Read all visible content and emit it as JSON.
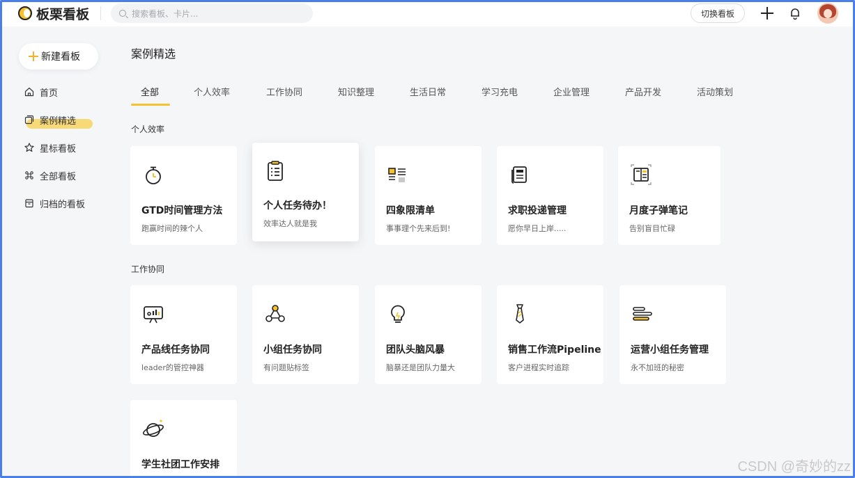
{
  "app": {
    "name": "板栗看板"
  },
  "search": {
    "placeholder": "搜索看板、卡片..."
  },
  "header": {
    "switch_label": "切换看板"
  },
  "sidebar": {
    "new_label": "新建看板",
    "items": [
      {
        "label": "首页",
        "icon": "home-icon"
      },
      {
        "label": "案例精选",
        "icon": "cases-icon",
        "active": true
      },
      {
        "label": "星标看板",
        "icon": "star-icon"
      },
      {
        "label": "全部看板",
        "icon": "command-icon"
      },
      {
        "label": "归档的看板",
        "icon": "archive-icon"
      }
    ]
  },
  "main": {
    "title": "案例精选",
    "tabs": [
      "全部",
      "个人效率",
      "工作协同",
      "知识整理",
      "生活日常",
      "学习充电",
      "企业管理",
      "产品开发",
      "活动策划"
    ],
    "active_tab": 0,
    "sections": [
      {
        "title": "个人效率",
        "cards": [
          {
            "title": "GTD时间管理方法",
            "subtitle": "跑赢时间的辣个人",
            "icon": "stopwatch-icon"
          },
          {
            "title": "个人任务待办！",
            "subtitle": "效率达人就是我",
            "icon": "checklist-icon"
          },
          {
            "title": "四象限清单",
            "subtitle": "事事理个先来后到!",
            "icon": "quadrant-icon"
          },
          {
            "title": "求职投递管理",
            "subtitle": "愿你早日上岸.....",
            "icon": "document-icon"
          },
          {
            "title": "月度子弹笔记",
            "subtitle": "告别盲目忙碌",
            "icon": "notebook-icon"
          }
        ]
      },
      {
        "title": "工作协同",
        "cards": [
          {
            "title": "产品线任务协同",
            "subtitle": "leader的管控神器",
            "icon": "presentation-icon"
          },
          {
            "title": "小组任务协同",
            "subtitle": "有问题贴标签",
            "icon": "team-icon"
          },
          {
            "title": "团队头脑风暴",
            "subtitle": "脑暴还是团队力量大",
            "icon": "lightbulb-icon"
          },
          {
            "title": "销售工作流Pipeline",
            "subtitle": "客户进程实时追踪",
            "icon": "tie-icon"
          },
          {
            "title": "运营小组任务管理",
            "subtitle": "永不加班的秘密",
            "icon": "bars-icon"
          }
        ]
      },
      {
        "title": "",
        "cards": [
          {
            "title": "学生社团工作安排",
            "subtitle": "",
            "icon": "planet-icon"
          }
        ]
      }
    ]
  },
  "watermark": "CSDN @奇妙的zz",
  "colors": {
    "accent": "#f6c12e",
    "frame": "#4a7ee8"
  }
}
